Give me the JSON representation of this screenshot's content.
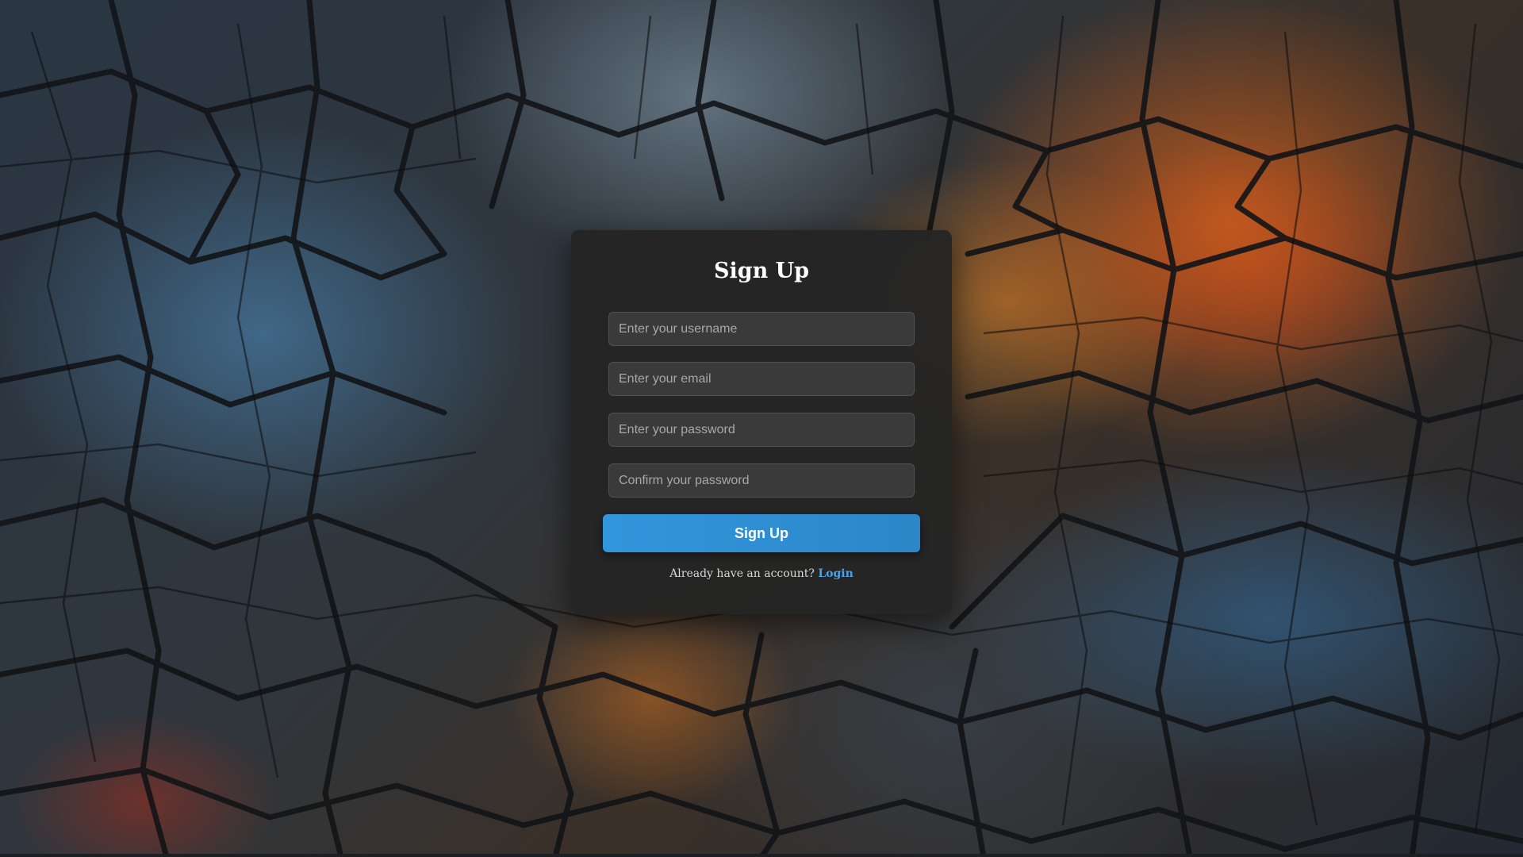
{
  "signup": {
    "title": "Sign Up",
    "username_placeholder": "Enter your username",
    "email_placeholder": "Enter your email",
    "password_placeholder": "Enter your password",
    "confirm_placeholder": "Confirm your password",
    "submit_label": "Sign Up",
    "footer_prompt": "Already have an account?",
    "login_link": "Login"
  },
  "colors": {
    "card_background": "#242424",
    "button_accent": "#3296dc",
    "link_accent": "#4aa3e8",
    "field_background": "#3a3a3a"
  }
}
